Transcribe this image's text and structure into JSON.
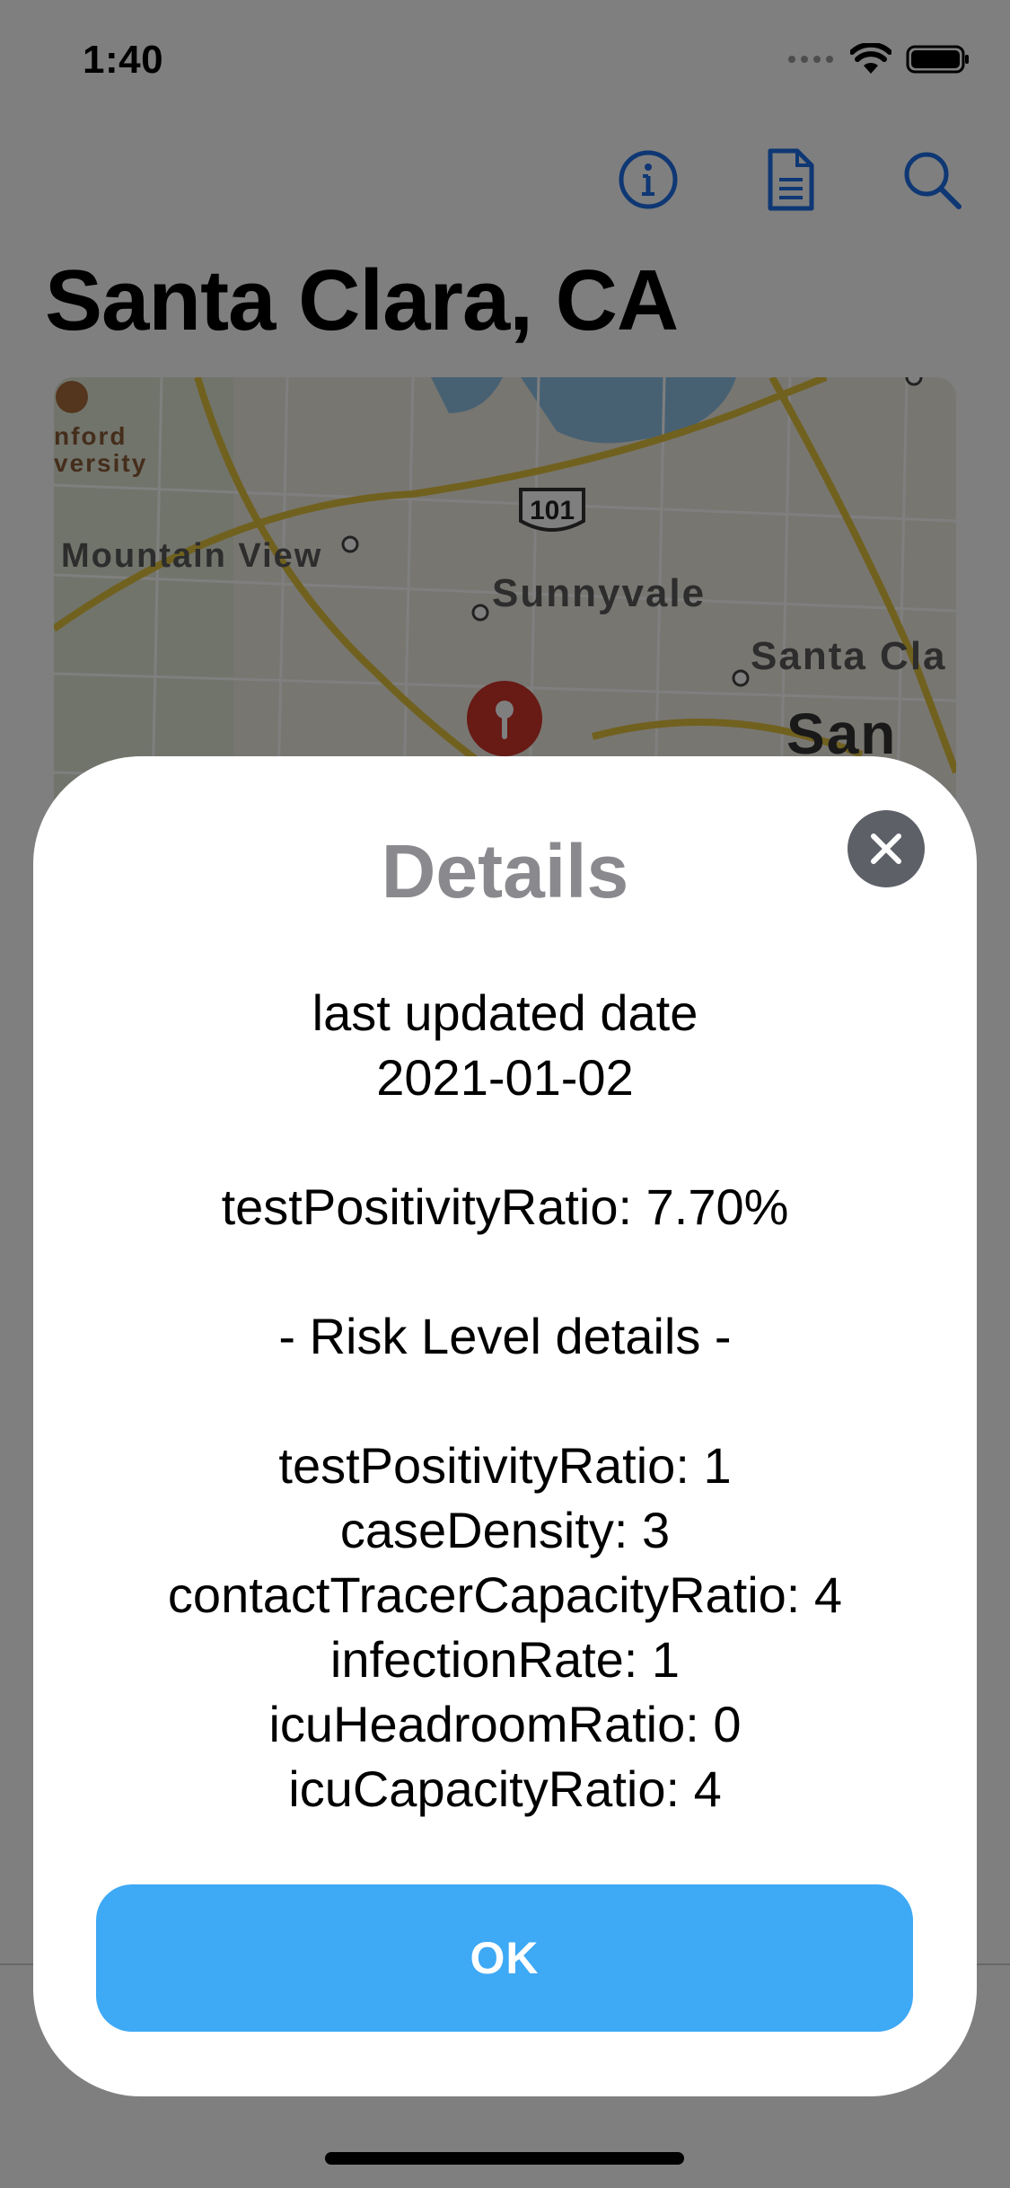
{
  "status_bar": {
    "time": "1:40"
  },
  "header": {
    "title": "Santa Clara, CA"
  },
  "map": {
    "labels": [
      "nford",
      "versity",
      "Mountain View",
      "Sunnyvale",
      "Santa Cla",
      "San"
    ],
    "highway": "101"
  },
  "modal": {
    "title": "Details",
    "lines": {
      "last_updated_label": "last updated date",
      "last_updated_value": "2021-01-02",
      "test_positivity": "testPositivityRatio: 7.70%",
      "risk_header": "- Risk Level details -",
      "risk_test_positivity": "testPositivityRatio: 1",
      "risk_case_density": "caseDensity: 3",
      "risk_contact_tracer": "contactTracerCapacityRatio: 4",
      "risk_infection_rate": "infectionRate: 1",
      "risk_icu_headroom": "icuHeadroomRatio: 0",
      "risk_icu_capacity": "icuCapacityRatio: 4"
    },
    "ok_label": "OK"
  },
  "colors": {
    "accent": "#3ea9f5",
    "icon_blue": "#1c6fe8",
    "title_gray": "#8a8a8e",
    "close_bg": "#5e6068"
  },
  "icons": [
    "info-icon",
    "document-icon",
    "search-icon",
    "close-icon",
    "map-pin-icon"
  ]
}
